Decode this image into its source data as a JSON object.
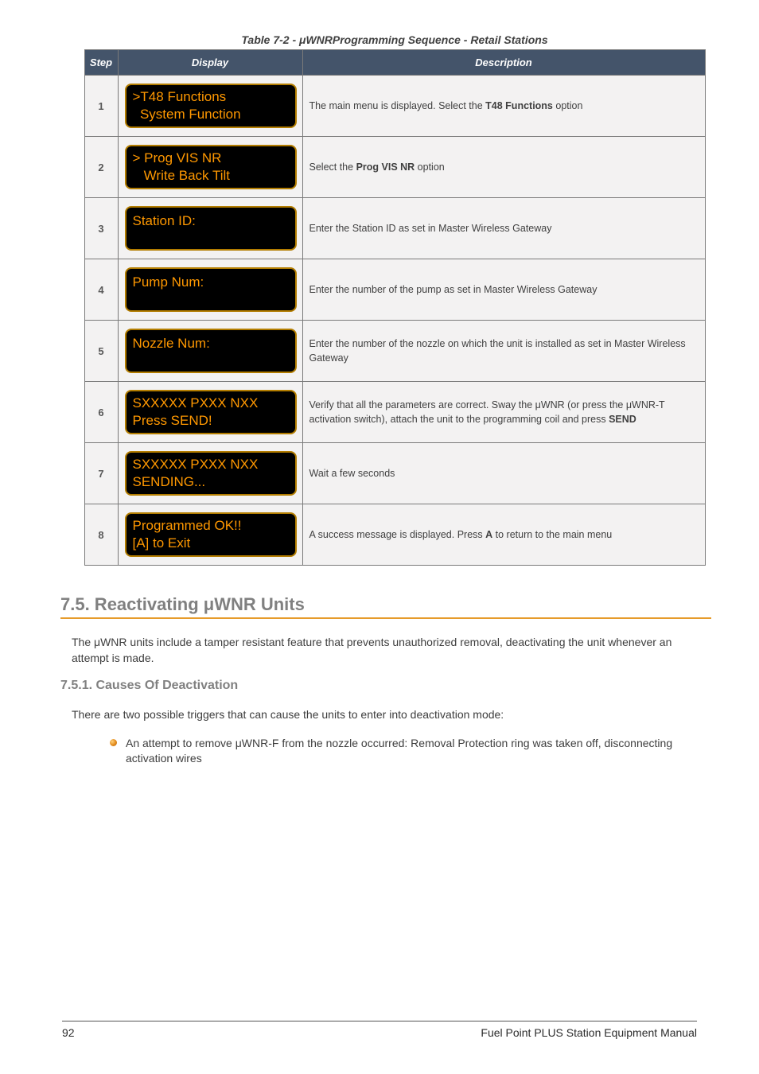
{
  "caption": "Table 7-2 - μWNRProgramming Sequence - Retail Stations",
  "headers": {
    "step": "Step",
    "display": "Display",
    "description": "Description"
  },
  "rows": [
    {
      "step": "1",
      "lcd": [
        ">T48 Functions",
        "  System Function"
      ],
      "desc": "The main menu is displayed. Select the <b>T48 Functions</b> option"
    },
    {
      "step": "2",
      "lcd": [
        "> Prog VIS NR",
        "   Write Back Tilt"
      ],
      "desc": "Select the <b>Prog VIS NR</b> option"
    },
    {
      "step": "3",
      "lcd": [
        "Station ID:"
      ],
      "desc": "Enter the Station ID as set in Master Wireless Gateway"
    },
    {
      "step": "4",
      "lcd": [
        "Pump Num:"
      ],
      "desc": "Enter the number of the pump as set in Master Wireless Gateway"
    },
    {
      "step": "5",
      "lcd": [
        "Nozzle Num:"
      ],
      "desc": "Enter the number of the nozzle on which the unit is installed as set in Master Wireless Gateway"
    },
    {
      "step": "6",
      "lcd": [
        "SXXXXX PXXX NXX",
        "Press SEND!"
      ],
      "desc": "Verify that all the parameters are correct. Sway the μWNR (or press the μWNR-T activation switch), attach the unit to the programming coil and press <b>SEND</b>"
    },
    {
      "step": "7",
      "lcd": [
        "SXXXXX PXXX NXX",
        "SENDING..."
      ],
      "desc": "Wait a few seconds"
    },
    {
      "step": "8",
      "lcd": [
        "Programmed OK!!",
        "[A] to Exit"
      ],
      "desc": "A success message is displayed. Press <b>A</b> to return to the main menu"
    }
  ],
  "section_title": "7.5. Reactivating μWNR Units",
  "para1": "The μWNR units include a tamper resistant feature that prevents unauthorized removal, deactivating the unit whenever an attempt is made.",
  "subsection_title": "7.5.1. Causes Of Deactivation",
  "para2": "There are two possible triggers that can cause the units to enter into deactivation mode:",
  "bullets": [
    "An attempt to remove μWNR-F from the nozzle occurred: Removal Protection ring was taken off, disconnecting activation wires"
  ],
  "footer": {
    "page": "92",
    "title": "Fuel Point PLUS Station Equipment Manual"
  }
}
